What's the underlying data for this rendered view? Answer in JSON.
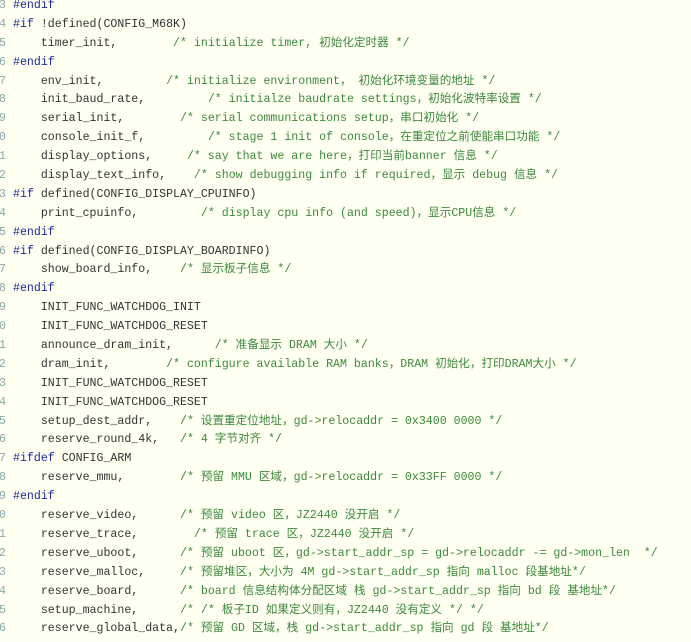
{
  "colors": {
    "background": "#fffff2",
    "keyword": "#1a2a9a",
    "comment": "#3c8a3c",
    "code": "#333333",
    "line_number": "#88aaaa"
  },
  "lines": [
    {
      "n": "3",
      "kw": "#endif",
      "text": "",
      "comment": ""
    },
    {
      "n": "4",
      "kw": "#if",
      "text": " !defined(CONFIG_M68K)",
      "comment": ""
    },
    {
      "n": "5",
      "kw": "",
      "text": "    timer_init,        ",
      "comment": "/* initialize timer, 初始化定时器 */"
    },
    {
      "n": "6",
      "kw": "#endif",
      "text": "",
      "comment": ""
    },
    {
      "n": "7",
      "kw": "",
      "text": "    env_init,         ",
      "comment": "/* initialize environment， 初始化环境变量的地址 */"
    },
    {
      "n": "8",
      "kw": "",
      "text": "    init_baud_rate,         ",
      "comment": "/* initialze baudrate settings，初始化波特率设置 */"
    },
    {
      "n": "9",
      "kw": "",
      "text": "    serial_init,        ",
      "comment": "/* serial communications setup，串口初始化 */"
    },
    {
      "n": "0",
      "kw": "",
      "text": "    console_init_f,         ",
      "comment": "/* stage 1 init of console，在重定位之前使能串口功能 */"
    },
    {
      "n": "1",
      "kw": "",
      "text": "    display_options,     ",
      "comment": "/* say that we are here，打印当前banner 信息 */"
    },
    {
      "n": "2",
      "kw": "",
      "text": "    display_text_info,    ",
      "comment": "/* show debugging info if required，显示 debug 信息 */"
    },
    {
      "n": "3",
      "kw": "#if",
      "text": " defined(CONFIG_DISPLAY_CPUINFO)",
      "comment": ""
    },
    {
      "n": "4",
      "kw": "",
      "text": "    print_cpuinfo,         ",
      "comment": "/* display cpu info (and speed)，显示CPU信息 */"
    },
    {
      "n": "5",
      "kw": "#endif",
      "text": "",
      "comment": ""
    },
    {
      "n": "6",
      "kw": "#if",
      "text": " defined(CONFIG_DISPLAY_BOARDINFO)",
      "comment": ""
    },
    {
      "n": "7",
      "kw": "",
      "text": "    show_board_info,    ",
      "comment": "/* 显示板子信息 */"
    },
    {
      "n": "8",
      "kw": "#endif",
      "text": "",
      "comment": ""
    },
    {
      "n": "9",
      "kw": "",
      "text": "    INIT_FUNC_WATCHDOG_INIT",
      "comment": ""
    },
    {
      "n": "0",
      "kw": "",
      "text": "    INIT_FUNC_WATCHDOG_RESET",
      "comment": ""
    },
    {
      "n": "1",
      "kw": "",
      "text": "    announce_dram_init,      ",
      "comment": "/* 准备显示 DRAM 大小 */"
    },
    {
      "n": "2",
      "kw": "",
      "text": "    dram_init,        ",
      "comment": "/* configure available RAM banks，DRAM 初始化，打印DRAM大小 */"
    },
    {
      "n": "3",
      "kw": "",
      "text": "    INIT_FUNC_WATCHDOG_RESET",
      "comment": ""
    },
    {
      "n": "4",
      "kw": "",
      "text": "    INIT_FUNC_WATCHDOG_RESET",
      "comment": ""
    },
    {
      "n": "5",
      "kw": "",
      "text": "    setup_dest_addr,    ",
      "comment": "/* 设置重定位地址，gd->relocaddr = 0x3400 0000 */"
    },
    {
      "n": "6",
      "kw": "",
      "text": "    reserve_round_4k,   ",
      "comment": "/* 4 字节对齐 */"
    },
    {
      "n": "7",
      "kw": "#ifdef",
      "text": " CONFIG_ARM",
      "comment": ""
    },
    {
      "n": "8",
      "kw": "",
      "text": "    reserve_mmu,        ",
      "comment": "/* 预留 MMU 区域，gd->relocaddr = 0x33FF 0000 */"
    },
    {
      "n": "9",
      "kw": "#endif",
      "text": "",
      "comment": ""
    },
    {
      "n": "0",
      "kw": "",
      "text": "    reserve_video,      ",
      "comment": "/* 预留 video 区，JZ2440 没开启 */"
    },
    {
      "n": "1",
      "kw": "",
      "text": "    reserve_trace,        ",
      "comment": "/* 预留 trace 区，JZ2440 没开启 */"
    },
    {
      "n": "2",
      "kw": "",
      "text": "    reserve_uboot,      ",
      "comment": "/* 预留 uboot 区，gd->start_addr_sp = gd->relocaddr -= gd->mon_len  */"
    },
    {
      "n": "3",
      "kw": "",
      "text": "    reserve_malloc,     ",
      "comment": "/* 预留堆区，大小为 4M gd->start_addr_sp 指向 malloc 段基地址*/"
    },
    {
      "n": "4",
      "kw": "",
      "text": "    reserve_board,      ",
      "comment": "/* board 信息结构体分配区域 栈 gd->start_addr_sp 指向 bd 段 基地址*/"
    },
    {
      "n": "5",
      "kw": "",
      "text": "    setup_machine,      ",
      "comment": "/* /* 板子ID 如果定义则有，JZ2440 没有定义 */ */"
    },
    {
      "n": "6",
      "kw": "",
      "text": "    reserve_global_data,",
      "comment": "/* 预留 GD 区域，栈 gd->start_addr_sp 指向 gd 段 基地址*/"
    }
  ]
}
